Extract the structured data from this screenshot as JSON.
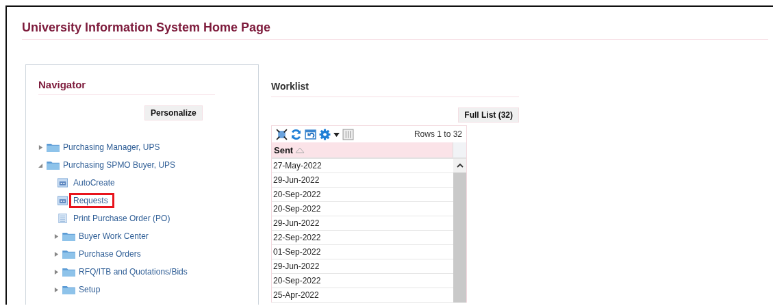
{
  "page_title": "University Information System Home Page",
  "navigator": {
    "title": "Navigator",
    "personalize_button": "Personalize",
    "tree": [
      {
        "label": "Purchasing Manager, UPS",
        "kind": "folder",
        "expanded": false,
        "highlighted": false
      },
      {
        "label": "Purchasing SPMO Buyer, UPS",
        "kind": "folder",
        "expanded": true,
        "highlighted": false,
        "children": [
          {
            "label": "AutoCreate",
            "kind": "function",
            "highlighted": false
          },
          {
            "label": "Requests",
            "kind": "function",
            "highlighted": true
          },
          {
            "label": "Print Purchase Order (PO)",
            "kind": "document",
            "highlighted": false
          },
          {
            "label": "Buyer Work Center",
            "kind": "folder",
            "expanded": false,
            "highlighted": false
          },
          {
            "label": "Purchase Orders",
            "kind": "folder",
            "expanded": false,
            "highlighted": false
          },
          {
            "label": "RFQ/ITB and Quotations/Bids",
            "kind": "folder",
            "expanded": false,
            "highlighted": false
          },
          {
            "label": "Setup",
            "kind": "folder",
            "expanded": false,
            "highlighted": false
          }
        ]
      }
    ]
  },
  "worklist": {
    "title": "Worklist",
    "full_list_button": "Full List (32)",
    "rows_label": "Rows 1 to 32",
    "column": {
      "label": "Sent",
      "sorted_ascending": true
    },
    "rows": [
      "27-May-2022",
      "29-Jun-2022",
      "20-Sep-2022",
      "20-Sep-2022",
      "29-Jun-2022",
      "22-Sep-2022",
      "01-Sep-2022",
      "29-Jun-2022",
      "20-Sep-2022",
      "25-Apr-2022"
    ]
  }
}
